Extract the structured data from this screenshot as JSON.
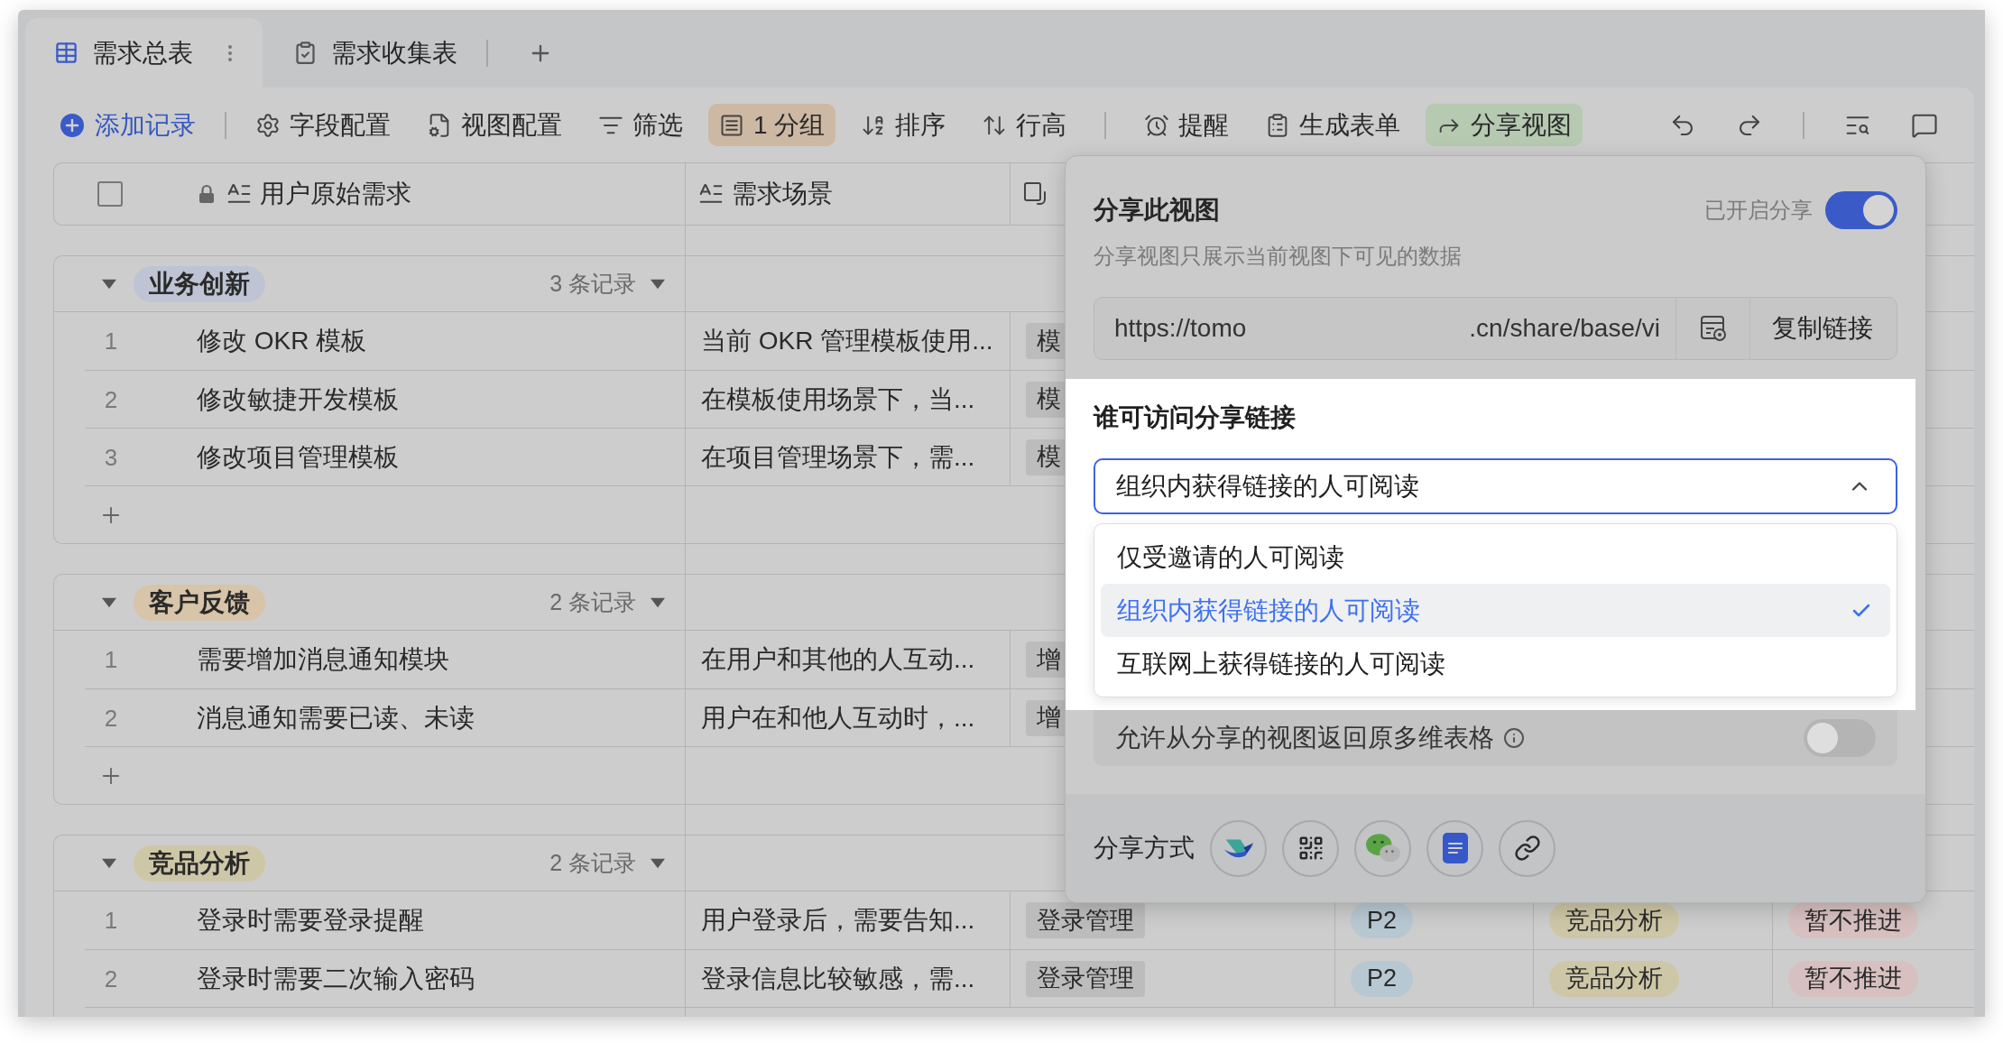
{
  "tabs": [
    {
      "label": "需求总表",
      "selected": true
    },
    {
      "label": "需求收集表",
      "selected": false
    }
  ],
  "toolbar": {
    "add_button": "添加记录",
    "items": [
      {
        "label": "字段配置",
        "active": false
      },
      {
        "label": "视图配置",
        "active": false
      },
      {
        "label": "筛选",
        "active": false
      },
      {
        "label": "1 分组",
        "active": true,
        "color": "#cdb8a3"
      },
      {
        "label": "排序",
        "active": false
      },
      {
        "label": "行高",
        "active": false
      },
      {
        "label": "提醒",
        "active": false
      },
      {
        "label": "生成表单",
        "active": false
      },
      {
        "label": "分享视图",
        "active": true,
        "color": "#b6c9b1"
      }
    ]
  },
  "table": {
    "select_all": {
      "checked": false
    },
    "columns": [
      {
        "label": "用户原始需求",
        "locked": true
      },
      {
        "label": "需求场景",
        "locked": false
      }
    ],
    "groups": [
      {
        "name": "业务创新",
        "color": "#bec4d4",
        "count": "3 条记录",
        "expanded": true,
        "rows": [
          {
            "number": "1",
            "request": "修改 OKR 模板",
            "scenario": "当前 OKR 管理模板使用...",
            "module": "模"
          },
          {
            "number": "2",
            "request": "修改敏捷开发模板",
            "scenario": "在模板使用场景下，当...",
            "module": "模"
          },
          {
            "number": "3",
            "request": "修改项目管理模板",
            "scenario": "在项目管理场景下，需...",
            "module": "模"
          }
        ]
      },
      {
        "name": "客户反馈",
        "color": "#d7c4a9",
        "count": "2 条记录",
        "expanded": true,
        "rows": [
          {
            "number": "1",
            "request": "需要增加消息通知模块",
            "scenario": "在用户和其他的人互动...",
            "module": "增"
          },
          {
            "number": "2",
            "request": "消息通知需要已读、未读",
            "scenario": "用户在和他人互动时，...",
            "module": "增"
          }
        ]
      },
      {
        "name": "竞品分析",
        "color": "#cec7a7",
        "count": "2 条记录",
        "expanded": true,
        "rows": [
          {
            "number": "1",
            "request": "登录时需要登录提醒",
            "scenario": "用户登录后，需要告知...",
            "module": "登录管理",
            "priority": "P2",
            "category": "竞品分析",
            "status": "暂不推进"
          },
          {
            "number": "2",
            "request": "登录时需要二次输入密码",
            "scenario": "登录信息比较敏感，需...",
            "module": "登录管理",
            "priority": "P2",
            "category": "竞品分析",
            "status": "暂不推进"
          }
        ]
      }
    ]
  },
  "share_panel": {
    "title": "分享此视图",
    "status_label": "已开启分享",
    "enabled": true,
    "description": "分享视图只展示当前视图下可见的数据",
    "link": {
      "start": "https://tomo",
      "end": ".cn/share/base/vi",
      "copy_button": "复制链接"
    },
    "access": {
      "title": "谁可访问分享链接",
      "value": "组织内获得链接的人可阅读",
      "expanded": true,
      "options": [
        {
          "label": "仅受邀请的人可阅读",
          "selected": false
        },
        {
          "label": "组织内获得链接的人可阅读",
          "selected": true
        },
        {
          "label": "互联网上获得链接的人可阅读",
          "selected": false
        }
      ]
    },
    "allow_return": {
      "label": "允许从分享的视图返回原多维表格",
      "on": false
    },
    "methods_label": "分享方式"
  }
}
